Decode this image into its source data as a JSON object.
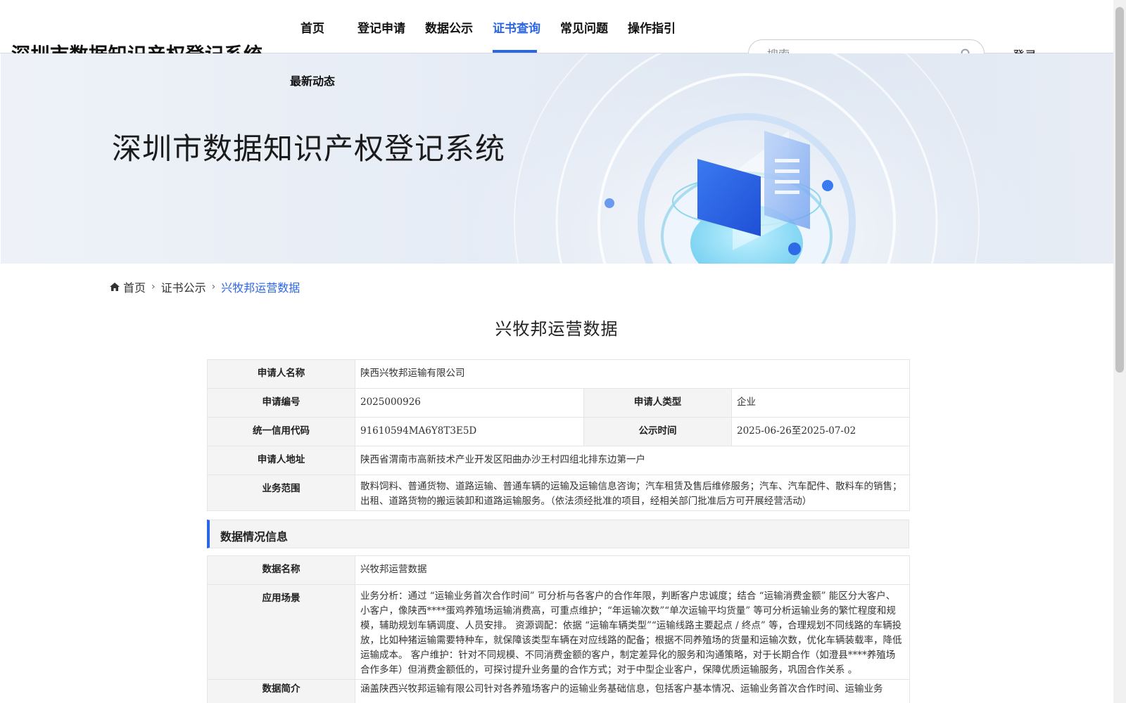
{
  "header": {
    "logo": "深圳市数据知识产权登记系统",
    "nav": [
      {
        "label": "首页"
      },
      {
        "label": "登记申请"
      },
      {
        "label": "数据公示"
      },
      {
        "label": "证书查询"
      },
      {
        "label": "常见问题"
      },
      {
        "label": "操作指引"
      },
      {
        "label": "最新动态"
      }
    ],
    "active_nav": "证书查询",
    "search_placeholder": "搜索",
    "login": "登录"
  },
  "banner": {
    "title": "深圳市数据知识产权登记系统"
  },
  "breadcrumb": {
    "home": "首页",
    "level2": "证书公示",
    "current": "兴牧邦运营数据"
  },
  "page_title": "兴牧邦运营数据",
  "applicant": {
    "name_label": "申请人名称",
    "name_value": "陕西兴牧邦运输有限公司",
    "no_label": "申请编号",
    "no_value": "2025000926",
    "type_label": "申请人类型",
    "type_value": "企业",
    "credit_label": "统一信用代码",
    "credit_value": "91610594MA6Y8T3E5D",
    "pub_label": "公示时间",
    "pub_value": "2025-06-26至2025-07-02",
    "addr_label": "申请人地址",
    "addr_value": "陕西省渭南市高新技术产业开发区阳曲办沙王村四组北排东边第一户",
    "scope_label": "业务范围",
    "scope_value": "散料饲料、普通货物、道路运输、普通车辆的运输及运输信息咨询；汽车租赁及售后维修服务；汽车、汽车配件、散料车的销售；出租、道路货物的搬运装卸和道路运输服务。（依法须经批准的项目，经相关部门批准后方可开展经营活动）"
  },
  "data_section": {
    "heading": "数据情况信息",
    "name_label": "数据名称",
    "name_value": "兴牧邦运营数据",
    "scene_label": "应用场景",
    "scene_value": "业务分析：通过 “运输业务首次合作时间” 可分析与各客户的合作年限，判断客户忠诚度；结合 “运输消费金额” 能区分大客户、小客户，像陕西****蛋鸡养殖场运输消费高，可重点维护；“年运输次数”“单次运输平均货量” 等可分析运输业务的繁忙程度和规模，辅助规划车辆调度、人员安排。 资源调配：依据 “运输车辆类型”“运输线路主要起点 / 终点” 等，合理规划不同线路的车辆投放，比如种猪运输需要特种车，就保障该类型车辆在对应线路的配备；根据不同养殖场的货量和运输次数，优化车辆装载率，降低运输成本。 客户维护：针对不同规模、不同消费金额的客户，制定差异化的服务和沟通策略，对于长期合作（如澄县****养殖场合作多年）但消费金额低的，可探讨提升业务量的合作方式；对于中型企业客户，保障优质运输服务，巩固合作关系 。",
    "intro_label": "数据简介",
    "intro_value": "涵盖陕西兴牧邦运输有限公司针对各养殖场客户的运输业务基础信息，包括客户基本情况、运输业务首次合作时间、运输业务"
  },
  "colors": {
    "accent": "#2b66e6",
    "label_bg": "#f4f4f4"
  }
}
